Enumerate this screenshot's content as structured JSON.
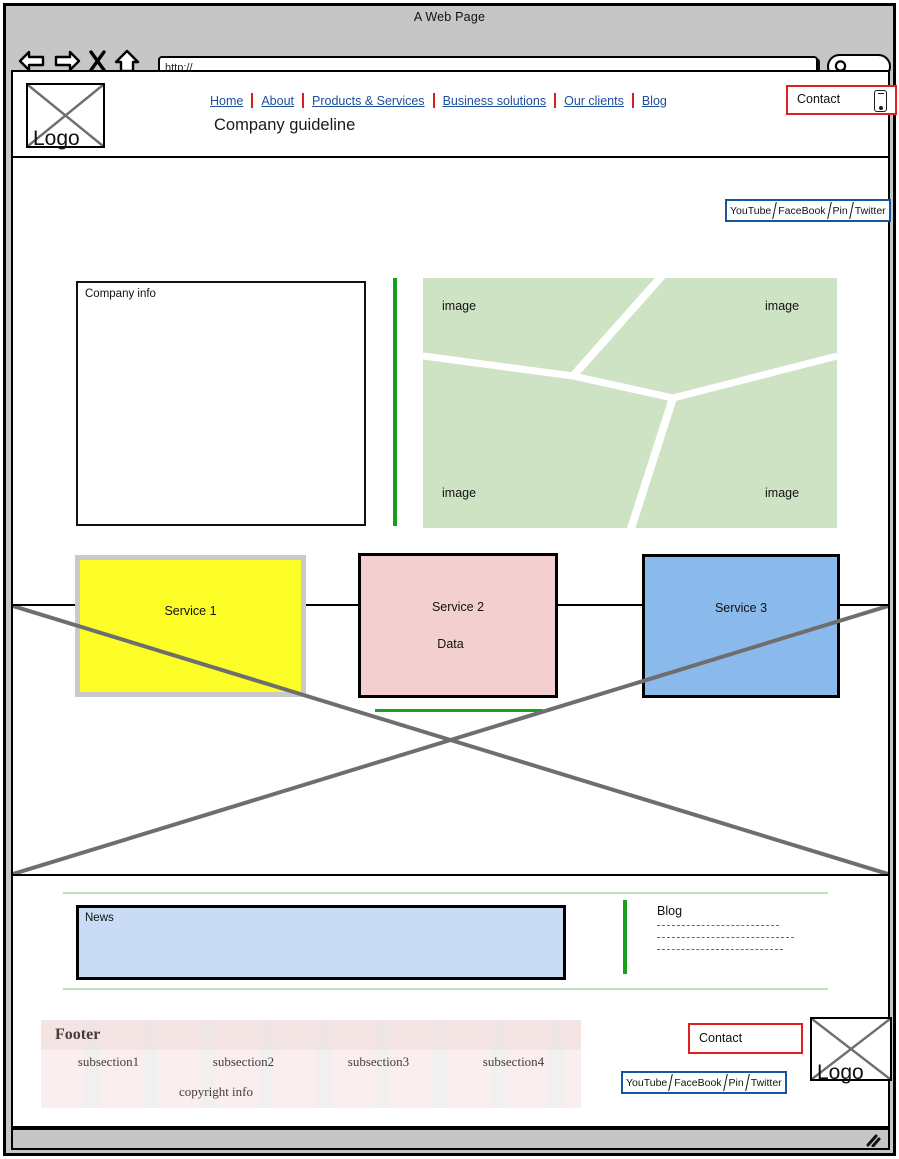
{
  "browser": {
    "window_title": "A Web Page",
    "url_value": "http://",
    "url_placeholder": "http://",
    "back_icon": "back-arrow-icon",
    "forward_icon": "forward-arrow-icon",
    "stop_icon": "close-x-icon",
    "home_icon": "home-icon",
    "search_icon": "magnifier-icon"
  },
  "header": {
    "logo_label": "Logo",
    "site_title": "Company guideline",
    "nav": [
      {
        "label": "Home"
      },
      {
        "label": "About"
      },
      {
        "label": "Products & Services"
      },
      {
        "label": "Business solutions"
      },
      {
        "label": "Our clients"
      },
      {
        "label": "Blog "
      }
    ],
    "contact_label": "Contact",
    "phone_icon": "mobile-phone-icon",
    "social": [
      "YouTube",
      "FaceBook",
      "Pin",
      "Twitter"
    ]
  },
  "main": {
    "company_info_label": "Company info",
    "image_labels": [
      "image",
      "image",
      "image",
      "image"
    ],
    "services": [
      {
        "label": "Service 1"
      },
      {
        "label": "Service 2"
      },
      {
        "label": "Service 3"
      }
    ]
  },
  "data_section": {
    "label": "Data",
    "placeholder_icon": "image-placeholder-cross-icon"
  },
  "news_section": {
    "news_label": "News",
    "blog_label": "Blog",
    "blog_lines": [
      "",
      "",
      ""
    ]
  },
  "footer": {
    "title": "Footer",
    "subsections": [
      "subsection1",
      "subsection2",
      "subsection3",
      "subsection4"
    ],
    "copyright": "copyright info",
    "contact_label": "Contact",
    "social": [
      "YouTube",
      "FaceBook",
      "Pin",
      "Twitter"
    ],
    "logo_label": "Logo"
  },
  "colors": {
    "link": "#1c4f9c",
    "separator_red": "#d42020",
    "contact_border": "#e02020",
    "social_border": "#1257a0",
    "accent_green": "#17a01c",
    "image_panel": "#cde3c4",
    "service1": "#fdfd28",
    "service2": "#f4cfcf",
    "service3": "#8ab9ec",
    "news": "#cadcf5",
    "footer_bg": "#fbeeee",
    "chrome": "#c6c6c6"
  }
}
